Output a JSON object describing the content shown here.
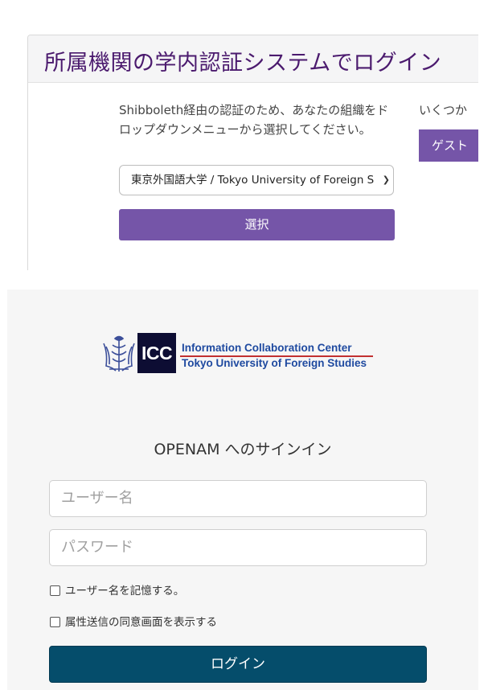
{
  "discovery": {
    "title": "所属機関の学内認証システムでログイン",
    "instructions": "Shibboleth経由の認証のため、あなたの組織をドロップダウンメニューから選択してください。",
    "org_select_value": "東京外国語大学 / Tokyo University of Foreign S",
    "select_button_label": "選択",
    "other_text": "いくつか",
    "guest_button_label": "ゲスト"
  },
  "login": {
    "logo": {
      "abbr": "ICC",
      "line1": "Information Collaboration Center",
      "line2": "Tokyo University of Foreign Studies"
    },
    "title": "OPENAM へのサインイン",
    "username_placeholder": "ユーザー名",
    "password_placeholder": "パスワード",
    "remember_label": "ユーザー名を記憶する。",
    "consent_label": "属性送信の同意画面を表示する",
    "login_button_label": "ログイン"
  },
  "colors": {
    "title_purple": "#4b1a6e",
    "button_purple": "#7555a8",
    "login_button": "#054d6b",
    "logo_navy": "#0d0d33",
    "logo_blue": "#1f4aa0"
  }
}
